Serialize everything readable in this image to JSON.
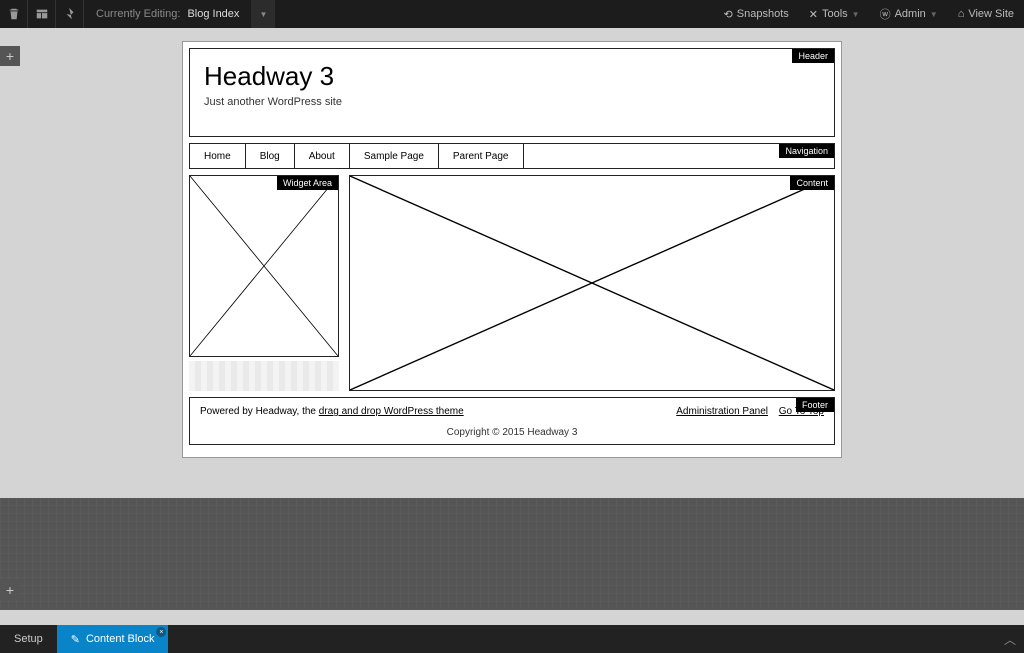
{
  "topbar": {
    "editing_label": "Currently Editing:",
    "editing_value": "Blog Index",
    "menus": {
      "snapshots": "Snapshots",
      "tools": "Tools",
      "admin": "Admin",
      "view_site": "View Site"
    }
  },
  "canvas": {
    "labels": {
      "header": "Header",
      "navigation": "Navigation",
      "widget_area": "Widget Area",
      "content": "Content",
      "footer": "Footer"
    },
    "site_title": "Headway 3",
    "tagline": "Just another WordPress site",
    "nav": [
      "Home",
      "Blog",
      "About",
      "Sample Page",
      "Parent Page"
    ],
    "footer": {
      "powered_pre": "Powered by Headway, the ",
      "powered_link": "drag and drop WordPress theme",
      "admin_panel": "Administration Panel",
      "go_to_top": "Go To Top",
      "copyright": "Copyright © 2015 Headway 3"
    }
  },
  "bottombar": {
    "setup": "Setup",
    "content_block": "Content Block"
  }
}
